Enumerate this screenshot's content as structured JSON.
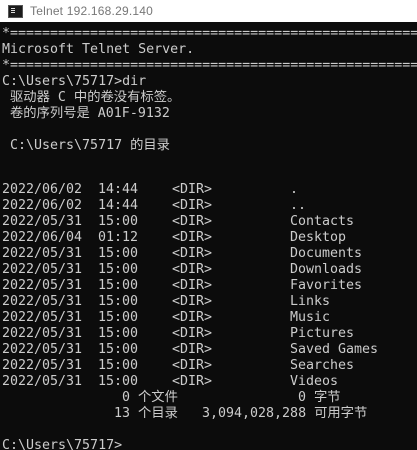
{
  "window": {
    "title": "Telnet 192.168.29.140",
    "icon": "console-icon"
  },
  "console": {
    "separator": "*===============================================================",
    "banner": "Microsoft Telnet Server.",
    "prompt_cmd": "C:\\Users\\75717>dir",
    "volume_label": " 驱动器 C 中的卷没有标签。",
    "volume_serial": " 卷的序列号是 A01F-9132",
    "dir_header": " C:\\Users\\75717 的目录",
    "entries": [
      {
        "date": "2022/06/02",
        "time": "14:44",
        "type": "<DIR>",
        "name": "."
      },
      {
        "date": "2022/06/02",
        "time": "14:44",
        "type": "<DIR>",
        "name": ".."
      },
      {
        "date": "2022/05/31",
        "time": "15:00",
        "type": "<DIR>",
        "name": "Contacts"
      },
      {
        "date": "2022/06/04",
        "time": "01:12",
        "type": "<DIR>",
        "name": "Desktop"
      },
      {
        "date": "2022/05/31",
        "time": "15:00",
        "type": "<DIR>",
        "name": "Documents"
      },
      {
        "date": "2022/05/31",
        "time": "15:00",
        "type": "<DIR>",
        "name": "Downloads"
      },
      {
        "date": "2022/05/31",
        "time": "15:00",
        "type": "<DIR>",
        "name": "Favorites"
      },
      {
        "date": "2022/05/31",
        "time": "15:00",
        "type": "<DIR>",
        "name": "Links"
      },
      {
        "date": "2022/05/31",
        "time": "15:00",
        "type": "<DIR>",
        "name": "Music"
      },
      {
        "date": "2022/05/31",
        "time": "15:00",
        "type": "<DIR>",
        "name": "Pictures"
      },
      {
        "date": "2022/05/31",
        "time": "15:00",
        "type": "<DIR>",
        "name": "Saved Games"
      },
      {
        "date": "2022/05/31",
        "time": "15:00",
        "type": "<DIR>",
        "name": "Searches"
      },
      {
        "date": "2022/05/31",
        "time": "15:00",
        "type": "<DIR>",
        "name": "Videos"
      }
    ],
    "summary_files": {
      "count": "0 个文件",
      "size": "0 字节"
    },
    "summary_dirs": {
      "count": "13 个目录",
      "size": "3,094,028,288 可用字节"
    },
    "final_prompt": "C:\\Users\\75717>"
  },
  "colors": {
    "background": "#0c0c0c",
    "text": "#cccccc",
    "titlebar": "#ffffff"
  }
}
